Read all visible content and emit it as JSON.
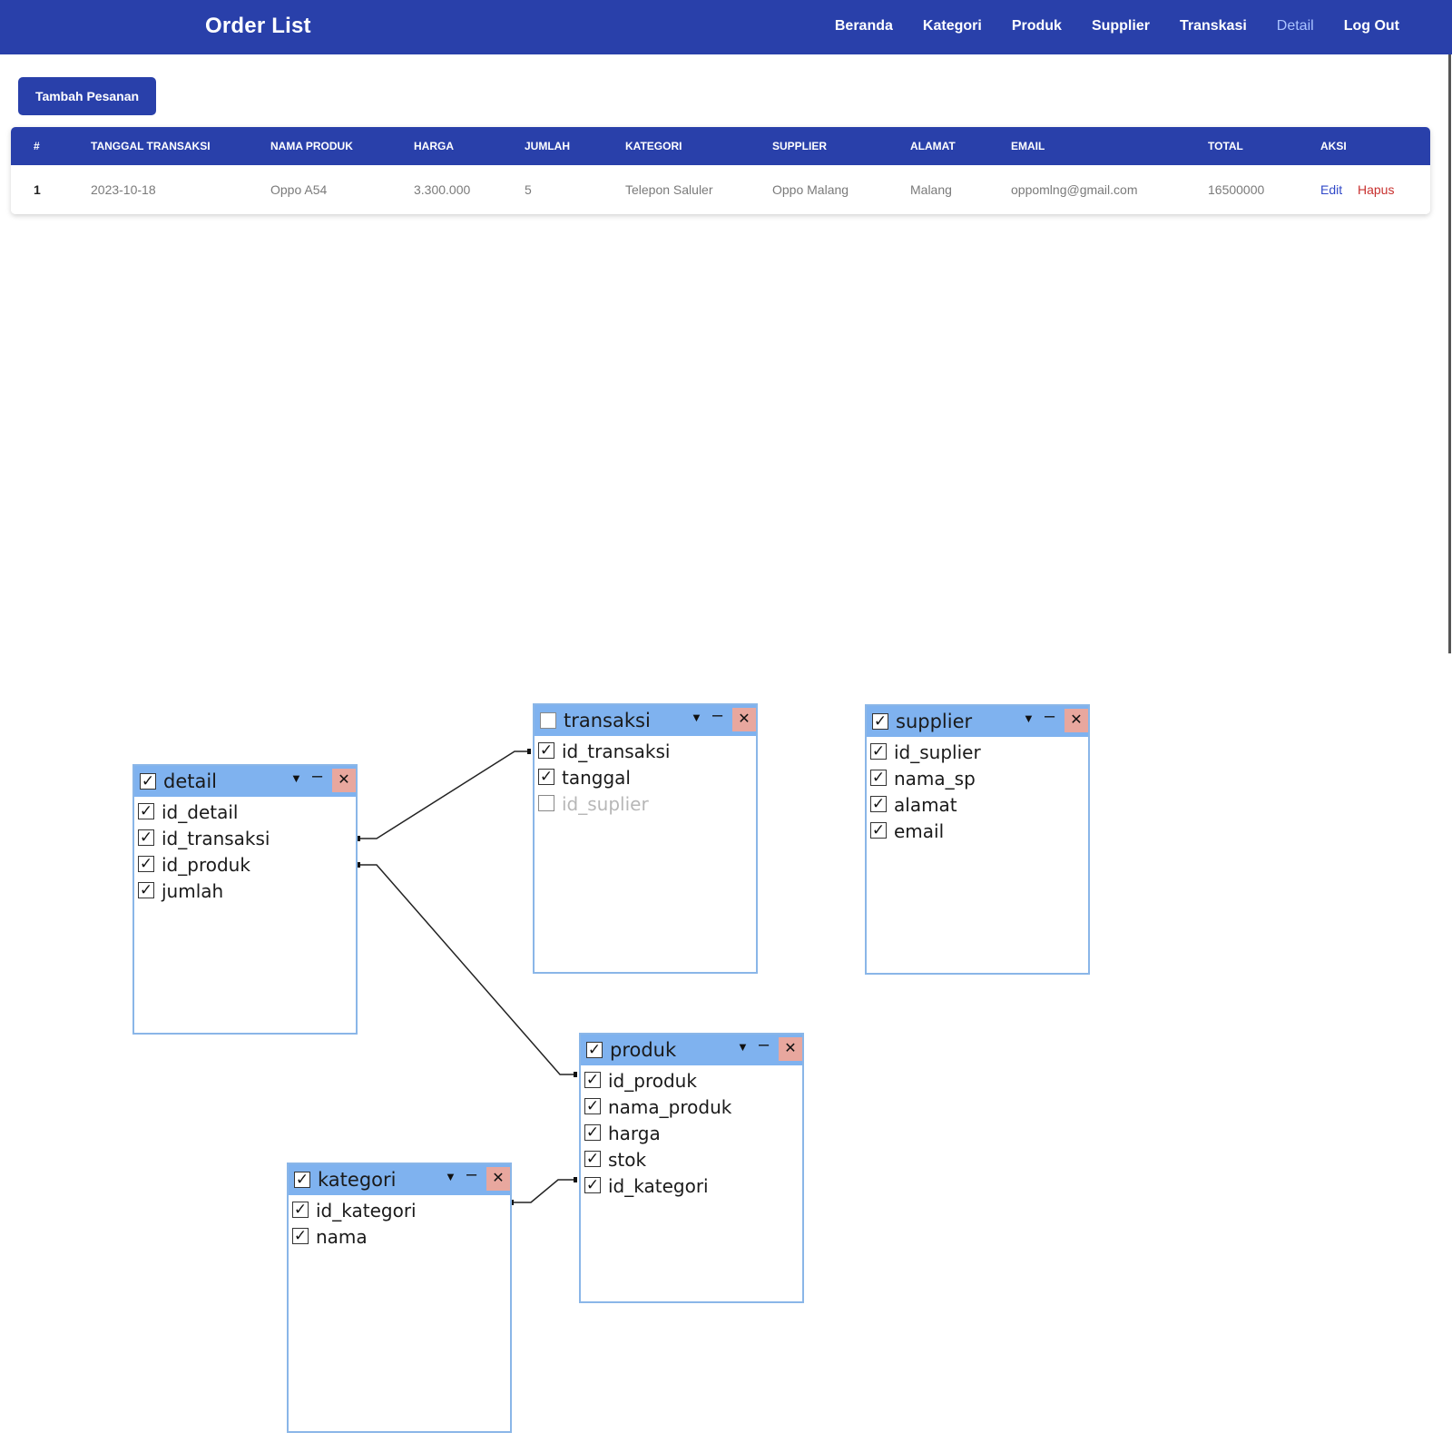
{
  "header": {
    "title": "Order List",
    "nav": [
      {
        "label": "Beranda",
        "active": false
      },
      {
        "label": "Kategori",
        "active": false
      },
      {
        "label": "Produk",
        "active": false
      },
      {
        "label": "Supplier",
        "active": false
      },
      {
        "label": "Transkasi",
        "active": false
      },
      {
        "label": "Detail",
        "active": true
      },
      {
        "label": "Log Out",
        "active": false
      }
    ]
  },
  "actions": {
    "add_label": "Tambah Pesanan"
  },
  "table": {
    "columns": [
      "#",
      "TANGGAL TRANSAKSI",
      "NAMA PRODUK",
      "HARGA",
      "JUMLAH",
      "KATEGORI",
      "SUPPLIER",
      "ALAMAT",
      "EMAIL",
      "TOTAL",
      "AKSI"
    ],
    "rows": [
      {
        "no": "1",
        "tanggal": "2023-10-18",
        "nama_produk": "Oppo A54",
        "harga": "3.300.000",
        "jumlah": "5",
        "kategori": "Telepon Saluler",
        "supplier": "Oppo Malang",
        "alamat": "Malang",
        "email": "oppomlng@gmail.com",
        "total": "16500000",
        "edit_label": "Edit",
        "delete_label": "Hapus"
      }
    ]
  },
  "colors": {
    "primary": "#2940aa",
    "active_nav": "#aac3ff",
    "edit_link": "#3048c8",
    "delete_link": "#c8302e",
    "er_header": "#7fb2ef",
    "er_border": "#8ab6e8",
    "er_close": "#e8a79e"
  },
  "er_designer": {
    "controls": {
      "dropdown": "▼",
      "minimize": "–",
      "close": "✕"
    },
    "tables": {
      "detail": {
        "name": "detail",
        "checked": true,
        "fields": [
          {
            "name": "id_detail",
            "checked": true
          },
          {
            "name": "id_transaksi",
            "checked": true
          },
          {
            "name": "id_produk",
            "checked": true
          },
          {
            "name": "jumlah",
            "checked": true
          }
        ]
      },
      "transaksi": {
        "name": "transaksi",
        "checked": false,
        "fields": [
          {
            "name": "id_transaksi",
            "checked": true
          },
          {
            "name": "tanggal",
            "checked": true
          },
          {
            "name": "id_suplier",
            "checked": false
          }
        ]
      },
      "supplier": {
        "name": "supplier",
        "checked": true,
        "fields": [
          {
            "name": "id_suplier",
            "checked": true
          },
          {
            "name": "nama_sp",
            "checked": true
          },
          {
            "name": "alamat",
            "checked": true
          },
          {
            "name": "email",
            "checked": true
          }
        ]
      },
      "produk": {
        "name": "produk",
        "checked": true,
        "fields": [
          {
            "name": "id_produk",
            "checked": true
          },
          {
            "name": "nama_produk",
            "checked": true
          },
          {
            "name": "harga",
            "checked": true
          },
          {
            "name": "stok",
            "checked": true
          },
          {
            "name": "id_kategori",
            "checked": true
          }
        ]
      },
      "kategori": {
        "name": "kategori",
        "checked": true,
        "fields": [
          {
            "name": "id_kategori",
            "checked": true
          },
          {
            "name": "nama",
            "checked": true
          }
        ]
      }
    }
  }
}
